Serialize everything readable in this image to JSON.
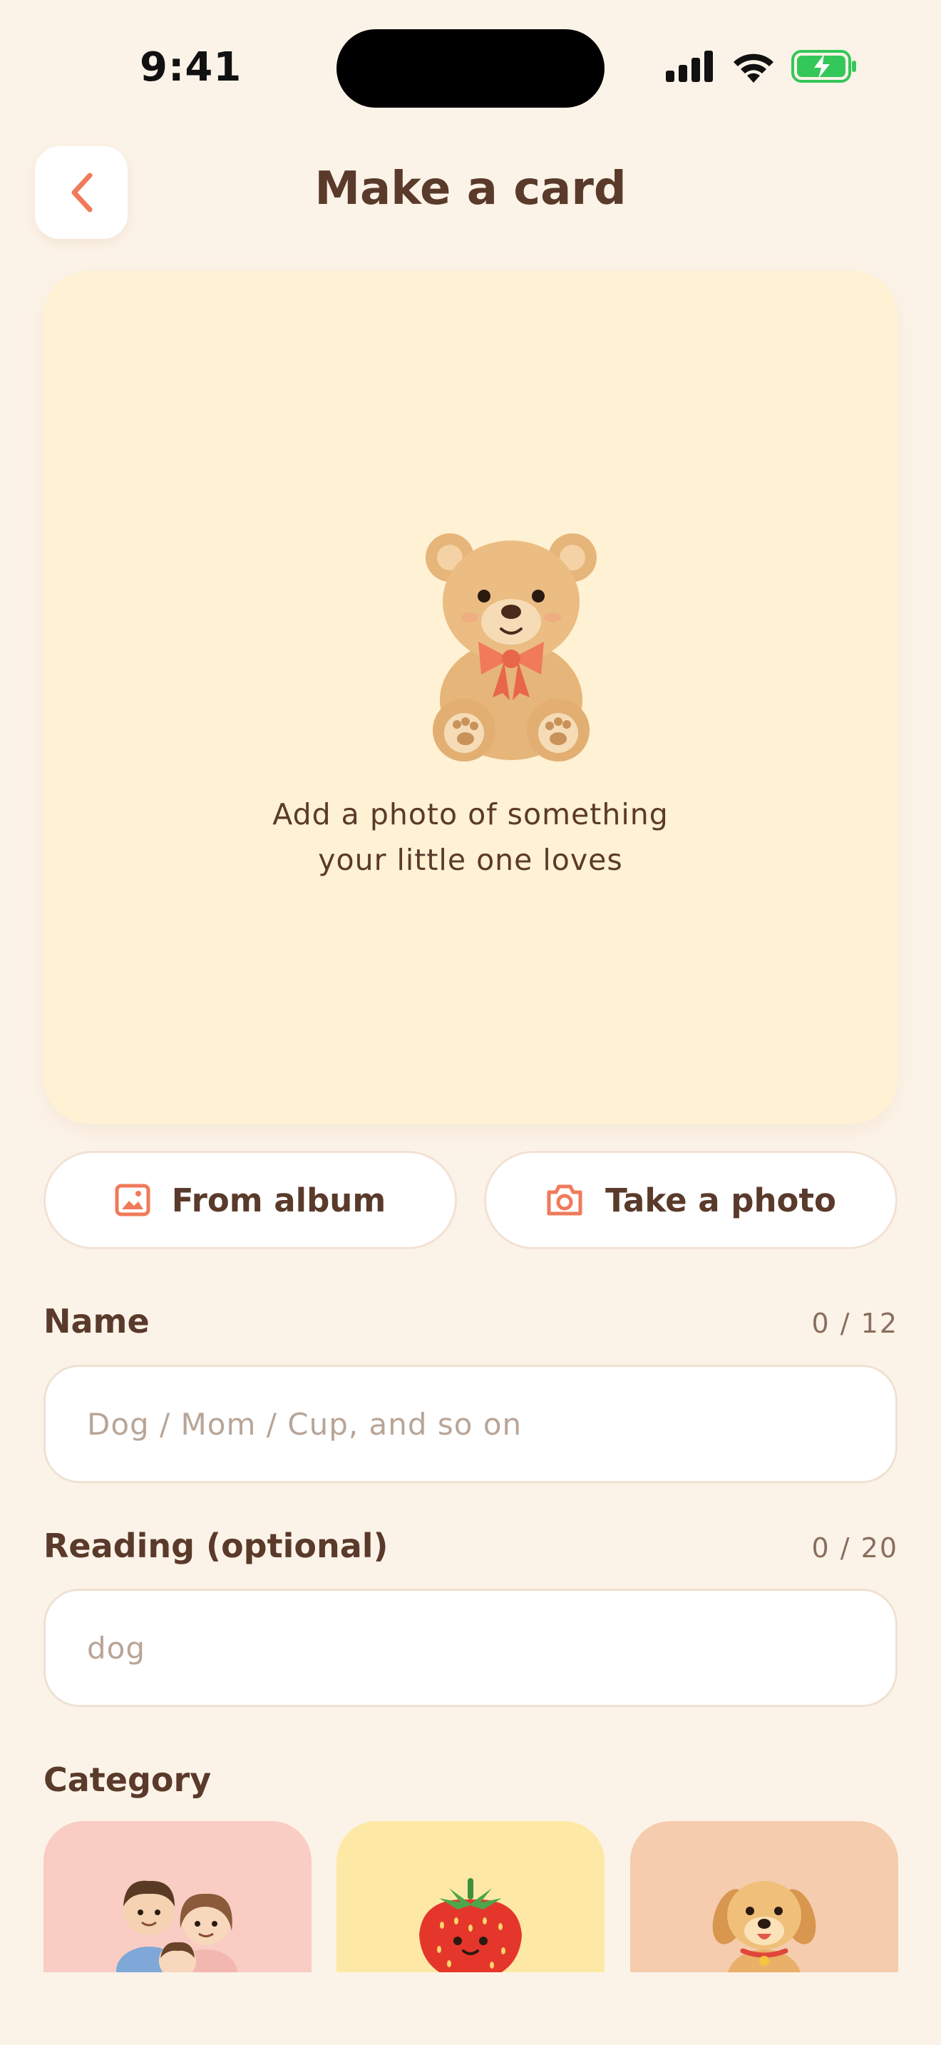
{
  "status_bar": {
    "time": "9:41"
  },
  "header": {
    "title": "Make a card"
  },
  "photo_card": {
    "hint_line1": "Add a photo of something",
    "hint_line2": "your little one loves"
  },
  "actions": {
    "album_label": "From album",
    "camera_label": "Take a photo"
  },
  "name_field": {
    "label": "Name",
    "count": "0 / 12",
    "placeholder": "Dog / Mom / Cup, and so on",
    "value": ""
  },
  "reading_field": {
    "label": "Reading (optional)",
    "count": "0 / 20",
    "placeholder": "dog",
    "value": ""
  },
  "category": {
    "label": "Category",
    "tiles": [
      {
        "icon": "family-icon",
        "color": "#F9CCC4"
      },
      {
        "icon": "strawberry-icon",
        "color": "#FDE9A5"
      },
      {
        "icon": "puppy-icon",
        "color": "#F5CCAE"
      }
    ]
  },
  "colors": {
    "accent": "#F07A5A",
    "background": "#FCF3E8",
    "text": "#5A3A2A",
    "battery": "#34C759"
  }
}
